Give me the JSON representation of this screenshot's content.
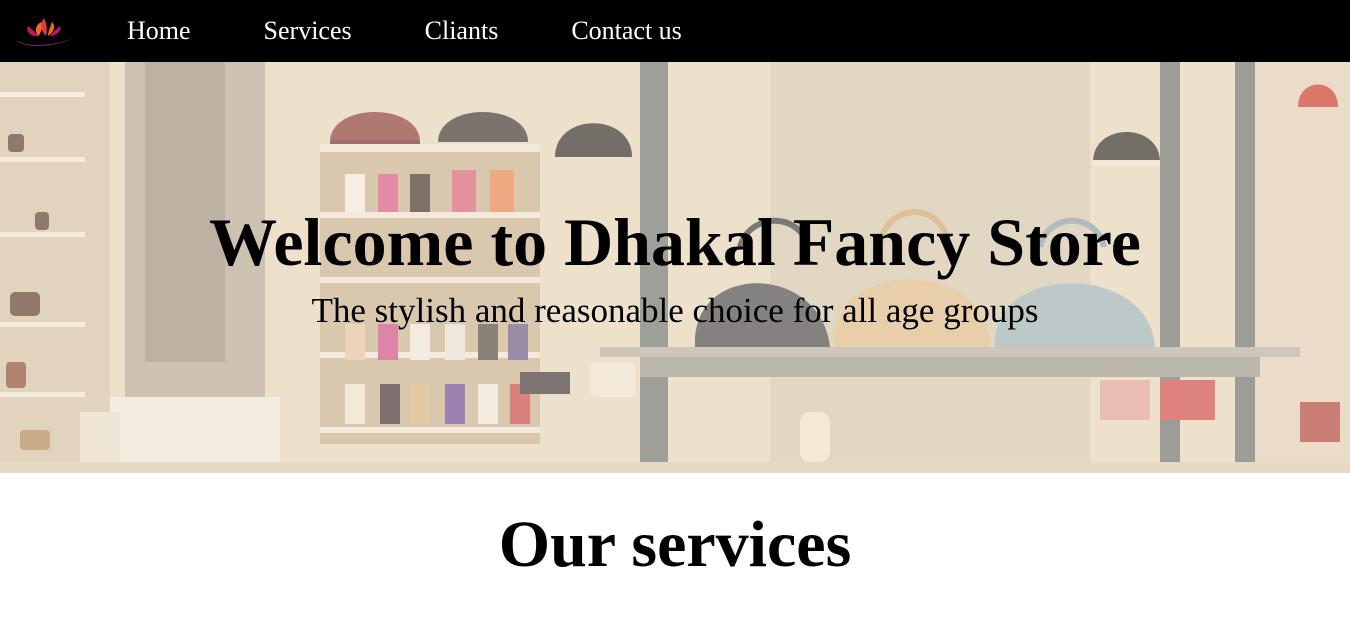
{
  "nav": {
    "logo_icon": "lotus-logo-icon",
    "items": [
      {
        "label": "Home"
      },
      {
        "label": "Services"
      },
      {
        "label": "Cliants"
      },
      {
        "label": "Contact us"
      }
    ]
  },
  "hero": {
    "title": "Welcome to Dhakal Fancy Store",
    "subtitle": "The stylish and reasonable choice for all age groups",
    "background": "handbag-store-shelves-photo"
  },
  "services": {
    "heading": "Our services"
  },
  "colors": {
    "nav_bg": "#000000",
    "nav_text": "#ffffff",
    "hero_tint": "#eadfca",
    "logo_pink": "#c2185b",
    "logo_orange": "#f26a1b"
  }
}
